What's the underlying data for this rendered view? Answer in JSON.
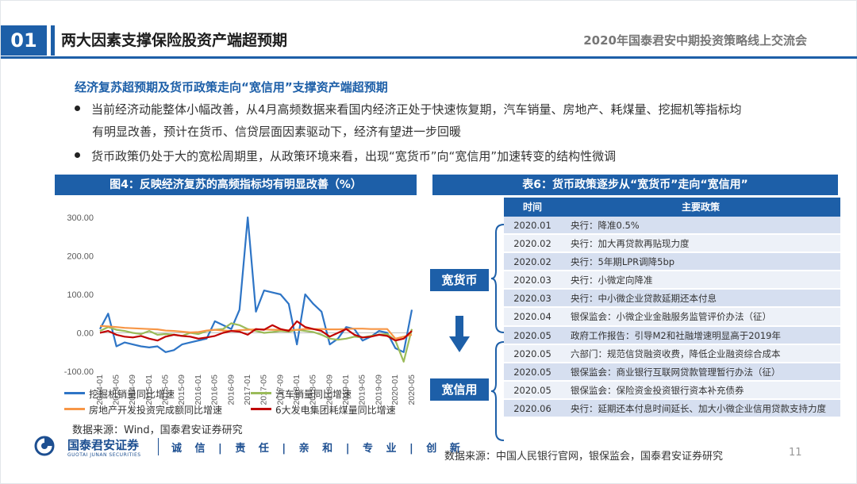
{
  "header": {
    "section_number": "01",
    "title": "两大因素支撑保险股资产端超预期",
    "event": "2020年国泰君安中期投资策略线上交流会"
  },
  "subtitle": "经济复苏超预期及货币政策走向“宽信用”支撑资产端超预期",
  "bullets": [
    "当前经济动能整体小幅改善，从4月高频数据来看国内经济正处于快速恢复期，汽车销量、房地产、耗煤量、挖掘机等指标均",
    "有明显改善，预计在货币、信贷层面因素驱动下，经济有望进一步回暖",
    "货币政策仍处于大的宽松周期里，从政策环境来看，出现“宽货币”向“宽信用”加速转变的结构性微调"
  ],
  "figure": {
    "caption": "图4：反映经济复苏的高频指标均有明显改善（%）",
    "source": "数据来源：Wind，国泰君安证券研究"
  },
  "chart_data": {
    "type": "line",
    "title": "",
    "xlabel": "",
    "ylabel": "",
    "ylim": [
      -100,
      300
    ],
    "yticks": [
      "300.00",
      "200.00",
      "100.00",
      "0.00",
      "-100.00"
    ],
    "xticks": [
      "2014-01",
      "2014-05",
      "2014-09",
      "2015-01",
      "2015-05",
      "2015-09",
      "2016-01",
      "2016-05",
      "2016-09",
      "2017-01",
      "2017-05",
      "2017-09",
      "2018-01",
      "2018-05",
      "2018-09",
      "2019-01",
      "2019-05",
      "2019-09",
      "2020-01",
      "2020-05"
    ],
    "x": [
      "2014-01",
      "2014-03",
      "2014-05",
      "2014-07",
      "2014-09",
      "2014-11",
      "2015-01",
      "2015-03",
      "2015-05",
      "2015-07",
      "2015-09",
      "2015-11",
      "2016-01",
      "2016-03",
      "2016-05",
      "2016-07",
      "2016-09",
      "2016-11",
      "2017-01",
      "2017-03",
      "2017-05",
      "2017-07",
      "2017-09",
      "2017-11",
      "2018-01",
      "2018-03",
      "2018-05",
      "2018-07",
      "2018-09",
      "2018-11",
      "2019-01",
      "2019-03",
      "2019-05",
      "2019-07",
      "2019-09",
      "2019-11",
      "2020-01",
      "2020-03",
      "2020-05"
    ],
    "series": [
      {
        "name": "挖掘机销量同比增速",
        "color": "#2e75c6",
        "values": [
          10,
          50,
          -35,
          -25,
          -30,
          -35,
          -38,
          -35,
          -50,
          -45,
          -30,
          -25,
          -20,
          -15,
          30,
          20,
          10,
          60,
          300,
          55,
          110,
          105,
          100,
          75,
          -30,
          100,
          75,
          55,
          -30,
          -15,
          15,
          10,
          -20,
          -10,
          5,
          0,
          -40,
          -50,
          60
        ]
      },
      {
        "name": "汽车销量同比增速",
        "color": "#9bbb59",
        "values": [
          5,
          15,
          8,
          5,
          0,
          -3,
          5,
          -5,
          -3,
          -5,
          -8,
          0,
          -3,
          5,
          8,
          10,
          25,
          20,
          10,
          5,
          0,
          2,
          5,
          3,
          8,
          5,
          2,
          -5,
          -15,
          -18,
          -15,
          -10,
          -12,
          -8,
          -5,
          -3,
          -20,
          -75,
          10
        ]
      },
      {
        "name": "房地产开发投资完成额同比增速",
        "color": "#f79646",
        "values": [
          18,
          17,
          15,
          13,
          12,
          11,
          10,
          9,
          6,
          5,
          3,
          1,
          2,
          6,
          8,
          6,
          5,
          7,
          8,
          9,
          9,
          8,
          8,
          7,
          8,
          10,
          10,
          10,
          9,
          9,
          10,
          11,
          11,
          10,
          10,
          10,
          -15,
          -10,
          -5
        ]
      },
      {
        "name": "6大发电集团耗煤量同比增速",
        "color": "#c00000",
        "values": [
          0,
          5,
          -5,
          -10,
          -12,
          -8,
          -15,
          -20,
          -10,
          -5,
          -8,
          -10,
          -15,
          -12,
          -8,
          0,
          5,
          3,
          -5,
          10,
          8,
          20,
          10,
          5,
          30,
          15,
          10,
          5,
          -10,
          0,
          10,
          -5,
          -12,
          -10,
          -5,
          -8,
          -20,
          -15,
          5
        ]
      }
    ]
  },
  "table": {
    "caption": "表6：货币政策逐步从“宽货币”走向“宽信用”",
    "headers": {
      "time": "时间",
      "policy": "主要政策"
    },
    "rows": [
      {
        "time": "2020.01",
        "policy": "央行：降准0.5%"
      },
      {
        "time": "2020.02",
        "policy": "央行：加大再贷款再贴现力度"
      },
      {
        "time": "2020.02",
        "policy": "央行：5年期LPR调降5bp"
      },
      {
        "time": "2020.03",
        "policy": "央行：小微定向降准"
      },
      {
        "time": "2020.03",
        "policy": "央行：中小微企业贷款延期还本付息"
      },
      {
        "time": "2020.04",
        "policy": "银保监会：小微企业金融服务监管评价办法（征）"
      },
      {
        "time": "2020.05",
        "policy": "政府工作报告：引导M2和社融增速明显高于2019年"
      },
      {
        "time": "2020.05",
        "policy": "六部门：规范信贷融资收费，降低企业融资综合成本"
      },
      {
        "time": "2020.05",
        "policy": "银保监会：商业银行互联网贷款管理暂行办法（征）"
      },
      {
        "time": "2020.05",
        "policy": "银保监会：保险资金投资银行资本补充债券"
      },
      {
        "time": "2020.06",
        "policy": "央行：延期还本付息时间延长、加大小微企业信用贷款支持力度"
      }
    ],
    "phase_loose_money": "宽货币",
    "phase_loose_credit": "宽信用",
    "source": "数据来源：中国人民银行官网，银保监会，国泰君安证券研究"
  },
  "footer": {
    "logo_cn": "国泰君安证券",
    "logo_en": "GUOTAI JUNAN SECURITIES",
    "slogan": "诚 信 | 责 任 | 亲 和 | 专 业 | 创 新",
    "page": "11"
  },
  "colors": {
    "brand": "#1d5fa8"
  }
}
